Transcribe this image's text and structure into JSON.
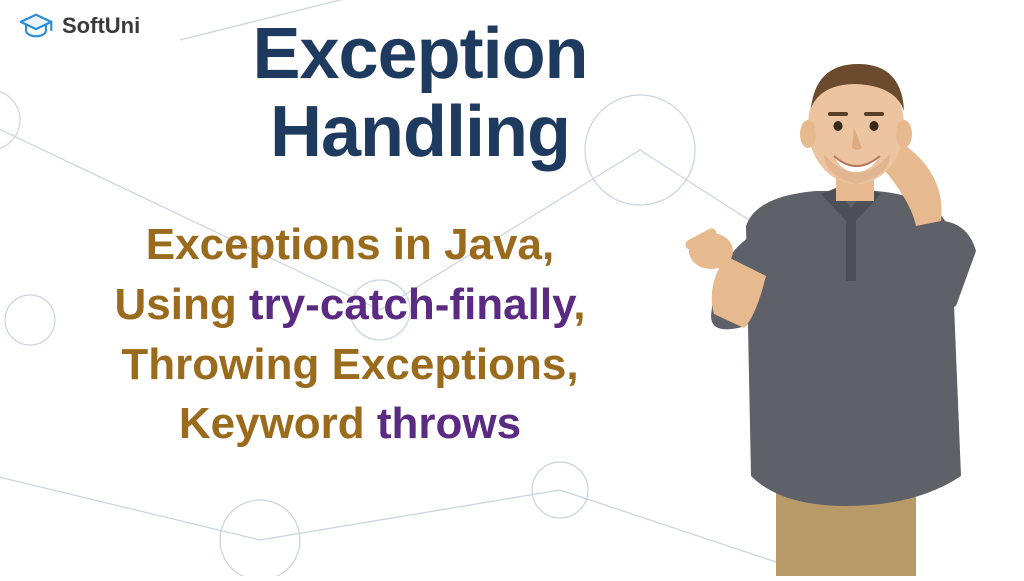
{
  "brand": {
    "name": "SoftUni",
    "logo_color": "#2b8dd6"
  },
  "title": {
    "line1": "Exception",
    "line2": "Handling",
    "color": "#1f3a5f"
  },
  "subtitle": {
    "line1_a": "Exceptions in Java,",
    "line2_a": "Using ",
    "line2_b": "try-catch-finally",
    "line2_c": ",",
    "line3_a": "Throwing Exceptions,",
    "line4_a": "Keyword ",
    "line4_b": "throws",
    "color_primary": "#9a6b1d",
    "color_keyword": "#5b2a82"
  }
}
